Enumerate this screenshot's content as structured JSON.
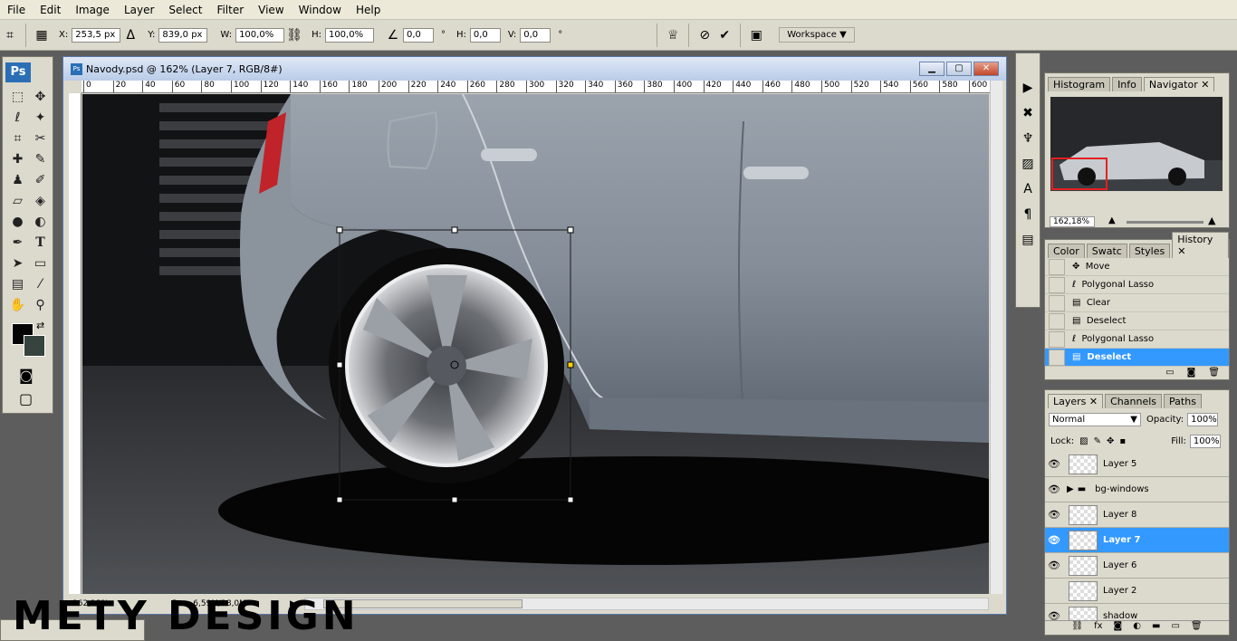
{
  "menu": [
    "File",
    "Edit",
    "Image",
    "Layer",
    "Select",
    "Filter",
    "View",
    "Window",
    "Help"
  ],
  "options": {
    "x_label": "X:",
    "x_value": "253,5 px",
    "y_label": "Y:",
    "y_value": "839,0 px",
    "w_label": "W:",
    "w_value": "100,0%",
    "h_label": "H:",
    "h_value": "100,0%",
    "angle_value": "0,0",
    "angle_unit": "°",
    "hs_label": "H:",
    "hs_value": "0,0",
    "vs_label": "V:",
    "vs_value": "0,0",
    "skew_unit": "°",
    "workspace": "Workspace"
  },
  "toolbox": {
    "logo": "Ps"
  },
  "document": {
    "title": "Navody.psd @ 162% (Layer 7, RGB/8#)",
    "zoom": "162,18%",
    "doc_size": "Doc: 6,59M/28,0M",
    "ruler_ticks": [
      "0",
      "20",
      "40",
      "60",
      "80",
      "100",
      "120",
      "140",
      "160",
      "180",
      "200",
      "220",
      "240",
      "260",
      "280",
      "300",
      "320",
      "340",
      "360",
      "380",
      "400",
      "420",
      "440",
      "460",
      "480",
      "500",
      "520",
      "540",
      "560",
      "580",
      "600"
    ]
  },
  "navigator": {
    "tabs": [
      "Histogram",
      "Info",
      "Navigator"
    ],
    "zoom": "162,18%"
  },
  "history": {
    "tabs": [
      "Color",
      "Swatc",
      "Styles",
      "History"
    ],
    "items": [
      {
        "label": "Move",
        "icon": "move-icon"
      },
      {
        "label": "Polygonal Lasso",
        "icon": "lasso-icon"
      },
      {
        "label": "Clear",
        "icon": "document-icon"
      },
      {
        "label": "Deselect",
        "icon": "document-icon"
      },
      {
        "label": "Polygonal Lasso",
        "icon": "lasso-icon"
      },
      {
        "label": "Deselect",
        "icon": "document-icon"
      }
    ]
  },
  "layers": {
    "tabs": [
      "Layers",
      "Channels",
      "Paths"
    ],
    "blend_mode": "Normal",
    "opacity_label": "Opacity:",
    "opacity": "100%",
    "lock_label": "Lock:",
    "fill_label": "Fill:",
    "fill": "100%",
    "items": [
      {
        "name": "Layer 5"
      },
      {
        "name": "bg-windows",
        "group": true
      },
      {
        "name": "Layer 8"
      },
      {
        "name": "Layer 7",
        "selected": true
      },
      {
        "name": "Layer 6"
      },
      {
        "name": "Layer 2"
      },
      {
        "name": "shadow"
      }
    ]
  },
  "watermark": "METY DESIGN",
  "colors": {
    "selection": "#3399ff",
    "foreground": "#050505",
    "background": "#36433f",
    "brand": "#2a6fb6"
  }
}
